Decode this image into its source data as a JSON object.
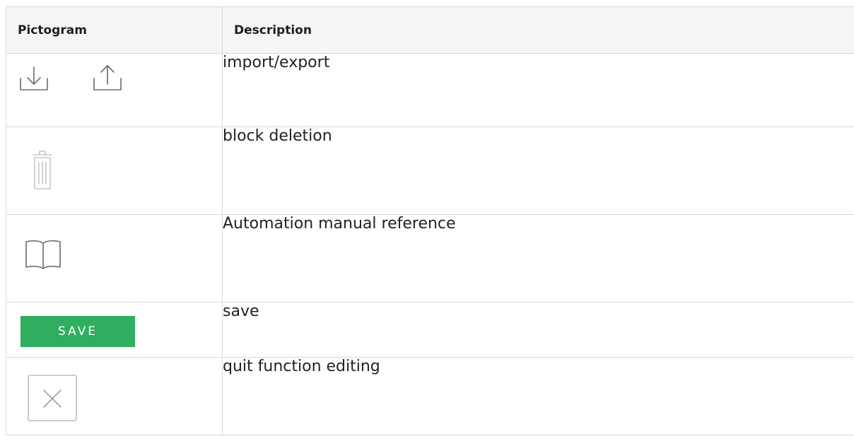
{
  "table": {
    "headers": {
      "pictogram": "Pictogram",
      "description": "Description"
    },
    "rows": [
      {
        "icons": [
          "import-icon",
          "export-icon"
        ],
        "description": "import/export"
      },
      {
        "icons": [
          "trash-icon"
        ],
        "description": "block deletion"
      },
      {
        "icons": [
          "book-icon"
        ],
        "description": "Automation manual reference"
      },
      {
        "icons": [
          "save-button"
        ],
        "button_label": "SAVE",
        "description": "save"
      },
      {
        "icons": [
          "close-icon"
        ],
        "description": "quit function editing"
      }
    ]
  },
  "colors": {
    "save_button": "#2fae5f",
    "icon_stroke": "#6b6b6b",
    "trash_stroke": "#c4c8cc",
    "border": "#d9d9d9",
    "header_bg": "#f4f5f7"
  }
}
